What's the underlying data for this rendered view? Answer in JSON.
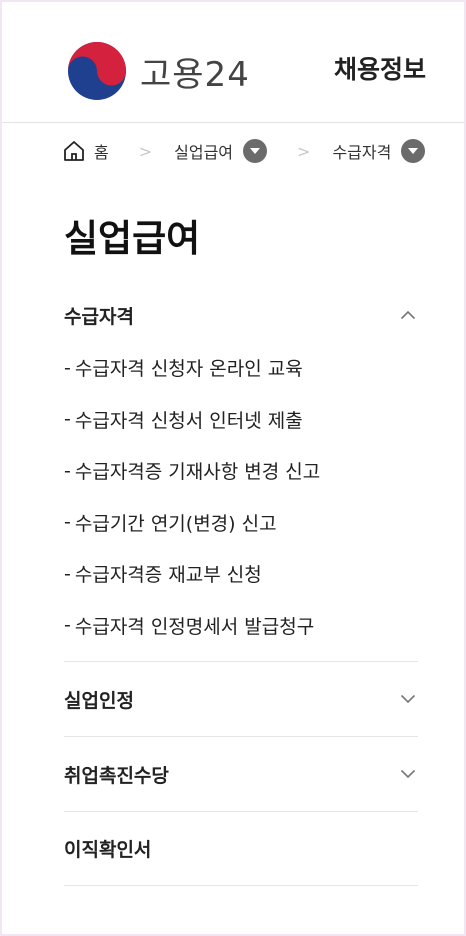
{
  "header": {
    "logo_text": "고용24",
    "menu_label": "채용정보"
  },
  "breadcrumb": {
    "home": "홈",
    "items": [
      "실업급여",
      "수급자격"
    ]
  },
  "page_title": "실업급여",
  "accordion": {
    "open_section": {
      "label": "수급자격",
      "items": [
        "수급자격 신청자 온라인 교육",
        "수급자격 신청서 인터넷 제출",
        "수급자격증 기재사항 변경 신고",
        "수급기간 연기(변경) 신고",
        "수급자격증 재교부 신청",
        "수급자격 인정명세서 발급청구"
      ]
    },
    "sections": [
      {
        "label": "실업인정",
        "has_chevron": true
      },
      {
        "label": "취업촉진수당",
        "has_chevron": true
      },
      {
        "label": "이직확인서",
        "has_chevron": false
      }
    ]
  },
  "colors": {
    "logo_red": "#d4213d",
    "logo_blue": "#1f3f8f",
    "caret_gray": "#6b6b6b",
    "divider": "#e6e6e6"
  }
}
